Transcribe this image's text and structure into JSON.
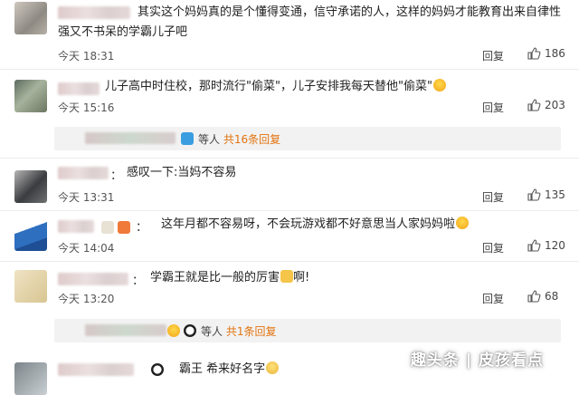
{
  "comments": [
    {
      "text1": "其实这个妈妈真的是个懂得变通，信守承诺的人，这样的妈妈才能教育出来自律性",
      "text2": "强又不书呆的学霸儿子吧",
      "time": "今天 18:31",
      "reply": "回复",
      "likes": "186"
    },
    {
      "text1": "儿子高中时住校，那时流行\"偷菜\"，儿子安排我每天替他\"偷菜\"",
      "time": "今天 15:16",
      "reply": "回复",
      "likes": "203",
      "sub_etc": "等人",
      "sub_count": "共16条回复"
    },
    {
      "text1": "感叹一下:当妈不容易",
      "time": "今天 13:31",
      "reply": "回复",
      "likes": "135"
    },
    {
      "text1": "这年月都不容易呀，不会玩游戏都不好意思当人家妈妈啦",
      "time": "今天 14:04",
      "reply": "回复",
      "likes": "120"
    },
    {
      "text1": "学霸王就是比一般的厉害",
      "text1_tail": "啊!",
      "time": "今天 13:20",
      "reply": "回复",
      "likes": "68",
      "sub_etc": "等人",
      "sub_count": "共1条回复"
    },
    {
      "text1": "霸王",
      "text1_tail": "希来好名字"
    }
  ],
  "colon": "：",
  "watermark": "趣头条 | 皮孩看点",
  "colors": {
    "accent_orange": "#e2730f",
    "subbar_bg": "#f2f2f2",
    "divider": "#ececec"
  }
}
